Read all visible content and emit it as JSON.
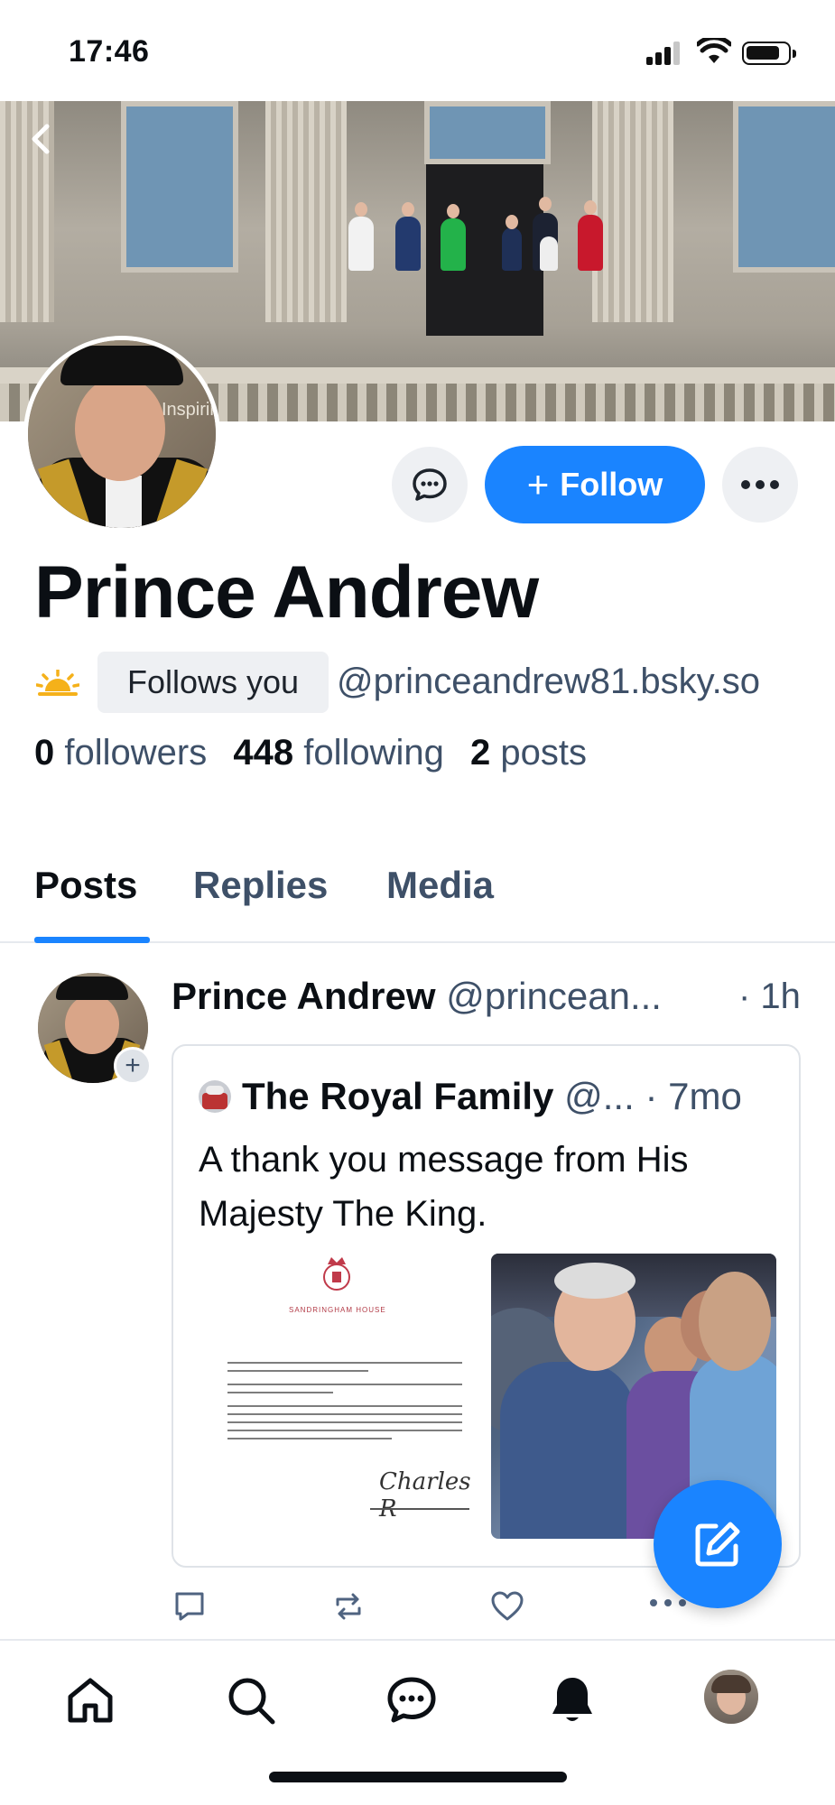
{
  "status_bar": {
    "time": "17:46"
  },
  "profile": {
    "display_name": "Prince Andrew",
    "follows_you_label": "Follows you",
    "handle": "@princeandrew81.bsky.so",
    "stats": {
      "followers_count": "0",
      "followers_label": "followers",
      "following_count": "448",
      "following_label": "following",
      "posts_count": "2",
      "posts_label": "posts"
    },
    "follow_button_label": "Follow",
    "avatar_badge_text": "Inspiring"
  },
  "tabs": [
    {
      "label": "Posts",
      "active": true
    },
    {
      "label": "Replies",
      "active": false
    },
    {
      "label": "Media",
      "active": false
    }
  ],
  "post": {
    "author": "Prince Andrew",
    "handle": "@princean...",
    "time": "· 1h",
    "quote": {
      "author": "The Royal Family",
      "handle": "@...",
      "time": "· 7mo",
      "text": "A thank you message from His Majesty The King.",
      "letter_heading": "SANDRINGHAM HOUSE",
      "letter_signature": "Charles R"
    }
  },
  "icons": {
    "back": "chevron-left-icon",
    "message": "message-bubble-icon",
    "more": "more-horizontal-icon",
    "sun": "sun-icon",
    "reply": "reply-icon",
    "repost": "repost-icon",
    "like": "heart-icon",
    "compose": "compose-icon",
    "home": "home-icon",
    "search": "search-icon",
    "chat": "chat-icon",
    "notifications": "bell-icon"
  },
  "colors": {
    "accent": "#1a84ff",
    "muted_text": "#3e5068",
    "badge_bg": "#eef0f3"
  }
}
